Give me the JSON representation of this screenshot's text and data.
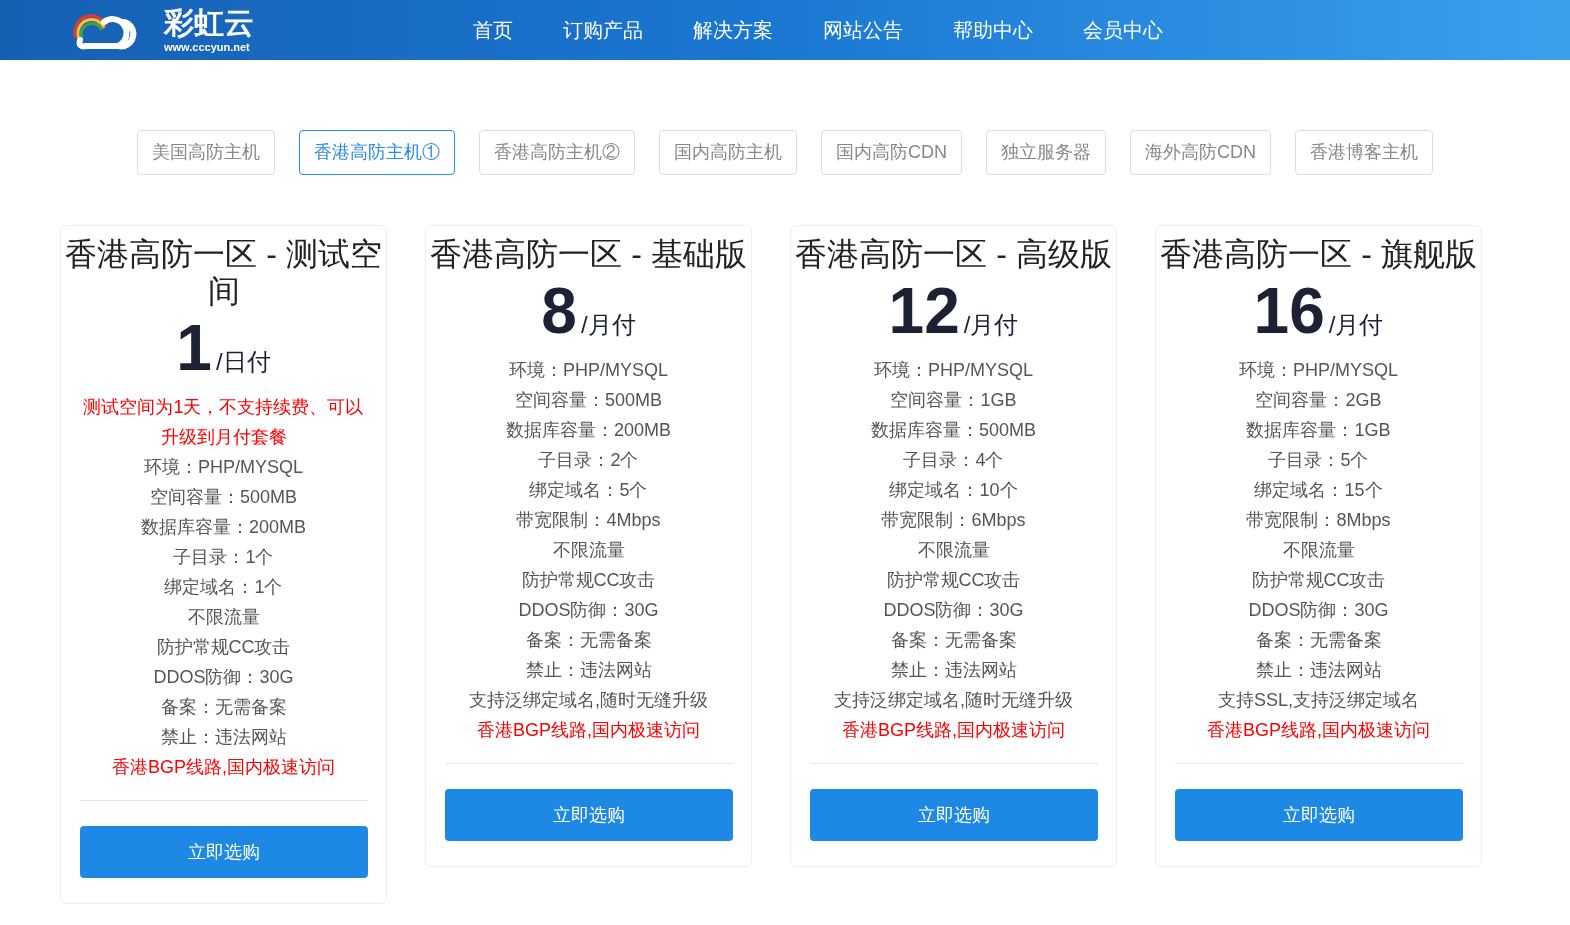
{
  "header": {
    "logo_name": "彩虹云",
    "logo_url": "www.cccyun.net",
    "nav": [
      {
        "label": "首页"
      },
      {
        "label": "订购产品"
      },
      {
        "label": "解决方案"
      },
      {
        "label": "网站公告"
      },
      {
        "label": "帮助中心"
      },
      {
        "label": "会员中心"
      }
    ]
  },
  "tabs": [
    {
      "label": "美国高防主机",
      "selected": false
    },
    {
      "label": "香港高防主机①",
      "selected": true
    },
    {
      "label": "香港高防主机②",
      "selected": false
    },
    {
      "label": "国内高防主机",
      "selected": false
    },
    {
      "label": "国内高防CDN",
      "selected": false
    },
    {
      "label": "独立服务器",
      "selected": false
    },
    {
      "label": "海外高防CDN",
      "selected": false
    },
    {
      "label": "香港博客主机",
      "selected": false
    }
  ],
  "plans": [
    {
      "title": "香港高防一区 - 测试空间",
      "price": "1",
      "unit": "/日付",
      "features": [
        {
          "kind": "highlight",
          "text": "测试空间为1天，不支持续费、可以升级到月付套餐"
        },
        {
          "kind": "normal",
          "text": "环境：PHP/MYSQL"
        },
        {
          "kind": "normal",
          "text": "空间容量：500MB"
        },
        {
          "kind": "normal",
          "text": "数据库容量：200MB"
        },
        {
          "kind": "normal",
          "text": "子目录：1个"
        },
        {
          "kind": "normal",
          "text": "绑定域名：1个"
        },
        {
          "kind": "normal",
          "text": "不限流量"
        },
        {
          "kind": "normal",
          "text": "防护常规CC攻击"
        },
        {
          "kind": "normal",
          "text": "DDOS防御：30G"
        },
        {
          "kind": "normal",
          "text": "备案：无需备案"
        },
        {
          "kind": "normal",
          "text": "禁止：违法网站"
        },
        {
          "kind": "highlight",
          "text": "香港BGP线路,国内极速访问"
        }
      ],
      "button": "立即选购"
    },
    {
      "title": "香港高防一区 - 基础版",
      "price": "8",
      "unit": "/月付",
      "features": [
        {
          "kind": "normal",
          "text": "环境：PHP/MYSQL"
        },
        {
          "kind": "normal",
          "text": "空间容量：500MB"
        },
        {
          "kind": "normal",
          "text": "数据库容量：200MB"
        },
        {
          "kind": "normal",
          "text": "子目录：2个"
        },
        {
          "kind": "normal",
          "text": "绑定域名：5个"
        },
        {
          "kind": "normal",
          "text": "带宽限制：4Mbps"
        },
        {
          "kind": "normal",
          "text": "不限流量"
        },
        {
          "kind": "normal",
          "text": "防护常规CC攻击"
        },
        {
          "kind": "normal",
          "text": "DDOS防御：30G"
        },
        {
          "kind": "normal",
          "text": "备案：无需备案"
        },
        {
          "kind": "normal",
          "text": "禁止：违法网站"
        },
        {
          "kind": "normal",
          "text": "支持泛绑定域名,随时无缝升级"
        },
        {
          "kind": "highlight",
          "text": "香港BGP线路,国内极速访问"
        }
      ],
      "button": "立即选购"
    },
    {
      "title": "香港高防一区 - 高级版",
      "price": "12",
      "unit": "/月付",
      "features": [
        {
          "kind": "normal",
          "text": "环境：PHP/MYSQL"
        },
        {
          "kind": "normal",
          "text": "空间容量：1GB"
        },
        {
          "kind": "normal",
          "text": "数据库容量：500MB"
        },
        {
          "kind": "normal",
          "text": "子目录：4个"
        },
        {
          "kind": "normal",
          "text": "绑定域名：10个"
        },
        {
          "kind": "normal",
          "text": "带宽限制：6Mbps"
        },
        {
          "kind": "normal",
          "text": "不限流量"
        },
        {
          "kind": "normal",
          "text": "防护常规CC攻击"
        },
        {
          "kind": "normal",
          "text": "DDOS防御：30G"
        },
        {
          "kind": "normal",
          "text": "备案：无需备案"
        },
        {
          "kind": "normal",
          "text": "禁止：违法网站"
        },
        {
          "kind": "normal",
          "text": "支持泛绑定域名,随时无缝升级"
        },
        {
          "kind": "highlight",
          "text": "香港BGP线路,国内极速访问"
        }
      ],
      "button": "立即选购"
    },
    {
      "title": "香港高防一区 - 旗舰版",
      "price": "16",
      "unit": "/月付",
      "features": [
        {
          "kind": "normal",
          "text": "环境：PHP/MYSQL"
        },
        {
          "kind": "normal",
          "text": "空间容量：2GB"
        },
        {
          "kind": "normal",
          "text": "数据库容量：1GB"
        },
        {
          "kind": "normal",
          "text": "子目录：5个"
        },
        {
          "kind": "normal",
          "text": "绑定域名：15个"
        },
        {
          "kind": "normal",
          "text": "带宽限制：8Mbps"
        },
        {
          "kind": "normal",
          "text": "不限流量"
        },
        {
          "kind": "normal",
          "text": "防护常规CC攻击"
        },
        {
          "kind": "normal",
          "text": "DDOS防御：30G"
        },
        {
          "kind": "normal",
          "text": "备案：无需备案"
        },
        {
          "kind": "normal",
          "text": "禁止：违法网站"
        },
        {
          "kind": "normal",
          "text": "支持SSL,支持泛绑定域名"
        },
        {
          "kind": "highlight",
          "text": "香港BGP线路,国内极速访问"
        }
      ],
      "button": "立即选购"
    }
  ]
}
